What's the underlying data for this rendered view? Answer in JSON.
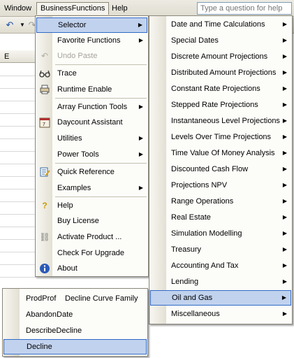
{
  "menubar": {
    "items": [
      "Window",
      "BusinessFunctions",
      "Help"
    ],
    "ask_placeholder": "Type a question for help"
  },
  "sheet": {
    "column_header": "E"
  },
  "main_menu": {
    "items": [
      {
        "label": "Selector",
        "submenu": true,
        "icon": ""
      },
      {
        "label": "Favorite Functions",
        "submenu": true,
        "icon": ""
      },
      {
        "label": "Undo Paste",
        "disabled": true,
        "icon": "undo-icon"
      },
      {
        "label": "Trace",
        "icon": "glasses-icon"
      },
      {
        "label": "Runtime Enable",
        "icon": "printer-icon"
      },
      {
        "label": "Array Function Tools",
        "submenu": true,
        "icon": ""
      },
      {
        "label": "Daycount Assistant",
        "icon": "calendar-icon"
      },
      {
        "label": "Utilities",
        "submenu": true,
        "icon": ""
      },
      {
        "label": "Power Tools",
        "submenu": true,
        "icon": ""
      },
      {
        "label": "Quick Reference",
        "icon": "notepad-icon"
      },
      {
        "label": "Examples",
        "submenu": true,
        "icon": ""
      },
      {
        "label": "Help",
        "icon": "help-bulb-icon"
      },
      {
        "label": "Buy License",
        "icon": ""
      },
      {
        "label": "Activate Product ...",
        "icon": "link-icon"
      },
      {
        "label": "Check For Upgrade",
        "icon": ""
      },
      {
        "label": "About",
        "icon": "info-icon"
      }
    ]
  },
  "selector_menu": {
    "items": [
      "Date and Time Calculations",
      "Special Dates",
      "Discrete Amount Projections",
      "Distributed Amount Projections",
      "Constant Rate Projections",
      "Stepped Rate Projections",
      "Instantaneous Level Projections",
      "Levels Over Time Projections",
      "Time Value Of Money Analysis",
      "Discounted Cash Flow",
      "Projections NPV",
      "Range Operations",
      "Real Estate",
      "Simulation Modelling",
      "Treasury",
      "Accounting And Tax",
      "Lending",
      "Oil and Gas",
      "Miscellaneous"
    ]
  },
  "oil_gas_menu": {
    "items": [
      {
        "label": "ProdProf",
        "extra": "Decline Curve Family"
      },
      {
        "label": "AbandonDate",
        "extra": ""
      },
      {
        "label": "DescribeDecline",
        "extra": ""
      },
      {
        "label": "Decline",
        "extra": ""
      }
    ]
  },
  "colors": {
    "highlight": "#c1d2ee",
    "highlight_border": "#316ac5"
  }
}
